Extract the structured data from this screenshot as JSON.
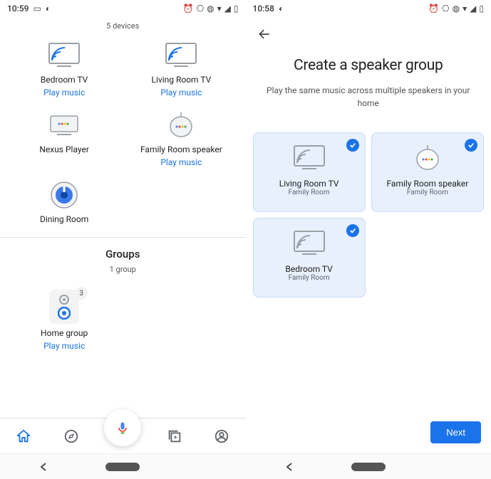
{
  "screen1": {
    "status": {
      "time": "10:59"
    },
    "devices_header": "5 devices",
    "devices": [
      {
        "name": "Bedroom TV",
        "action": "Play music",
        "type": "tv"
      },
      {
        "name": "Living Room TV",
        "action": "Play music",
        "type": "tv"
      },
      {
        "name": "Nexus Player",
        "action": "",
        "type": "player"
      },
      {
        "name": "Family Room speaker",
        "action": "Play music",
        "type": "mini"
      },
      {
        "name": "Dining Room",
        "action": "",
        "type": "nest"
      }
    ],
    "groups_title": "Groups",
    "groups_subheader": "1 group",
    "group": {
      "name": "Home group",
      "action": "Play music",
      "count": "3"
    },
    "nav": {
      "home": "home",
      "discover": "discover",
      "mic": "mic",
      "media": "media",
      "account": "account"
    }
  },
  "screen2": {
    "status": {
      "time": "10:58"
    },
    "title": "Create a speaker group",
    "subtitle": "Play the same music across multiple speakers in your home",
    "speakers": [
      {
        "name": "Living Room TV",
        "room": "Family Room",
        "type": "tv"
      },
      {
        "name": "Family Room speaker",
        "room": "Family Room",
        "type": "mini"
      },
      {
        "name": "Bedroom TV",
        "room": "Family Room",
        "type": "tv"
      }
    ],
    "next_label": "Next"
  }
}
